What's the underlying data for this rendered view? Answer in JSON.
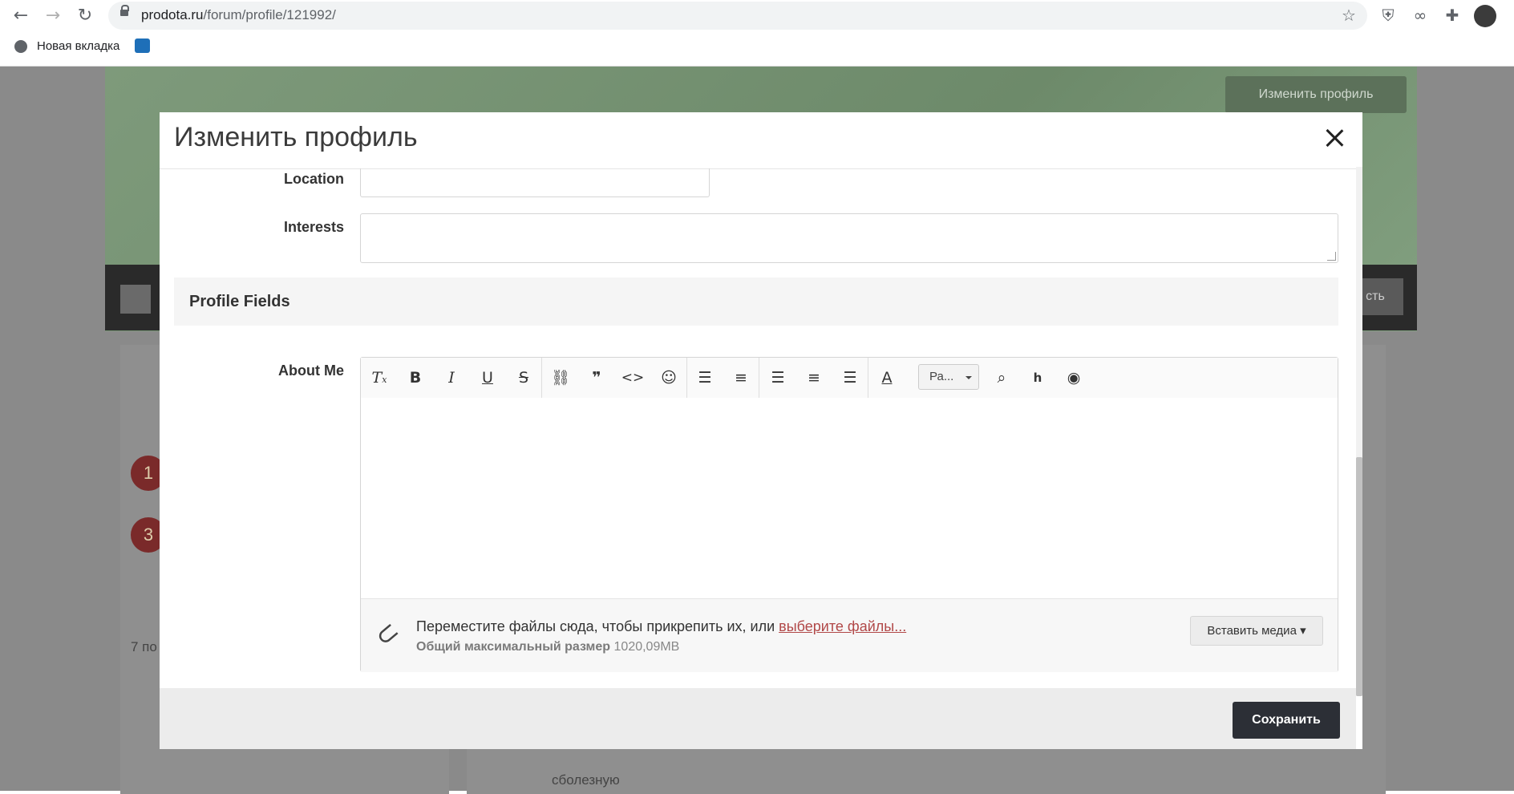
{
  "browser": {
    "url_host": "prodota.ru",
    "url_path": "/forum/profile/121992/",
    "bookmark_label": "Новая вкладка"
  },
  "background": {
    "edit_profile_label": "Изменить профиль",
    "follow_label_partial": "сть",
    "left_numbers": [
      "1",
      "3"
    ],
    "left_caption": "7 по",
    "activity_text": "сболезную"
  },
  "modal": {
    "title": "Изменить профиль",
    "fields": {
      "location_label": "Location",
      "interests_label": "Interests",
      "about_label": "About Me"
    },
    "section_title": "Profile Fields",
    "toolbar": {
      "font_select": "Ра...",
      "buttons": [
        "clear-format-icon",
        "bold-icon",
        "italic-icon",
        "underline-icon",
        "strikethrough-icon",
        "link-icon",
        "quote-icon",
        "code-icon",
        "smiley-icon",
        "bullet-list-icon",
        "numbered-list-icon",
        "align-left-icon",
        "align-center-icon",
        "align-right-icon",
        "text-color-icon",
        "preview-doc-icon",
        "html-icon",
        "eye-icon"
      ]
    },
    "attach": {
      "text": "Переместите файлы сюда, чтобы прикрепить их, или ",
      "link": "выберите файлы...",
      "size_label": "Общий максимальный размер",
      "size_value": "1020,09MB",
      "insert_media_label": "Вставить медиа"
    },
    "save_label": "Сохранить"
  }
}
